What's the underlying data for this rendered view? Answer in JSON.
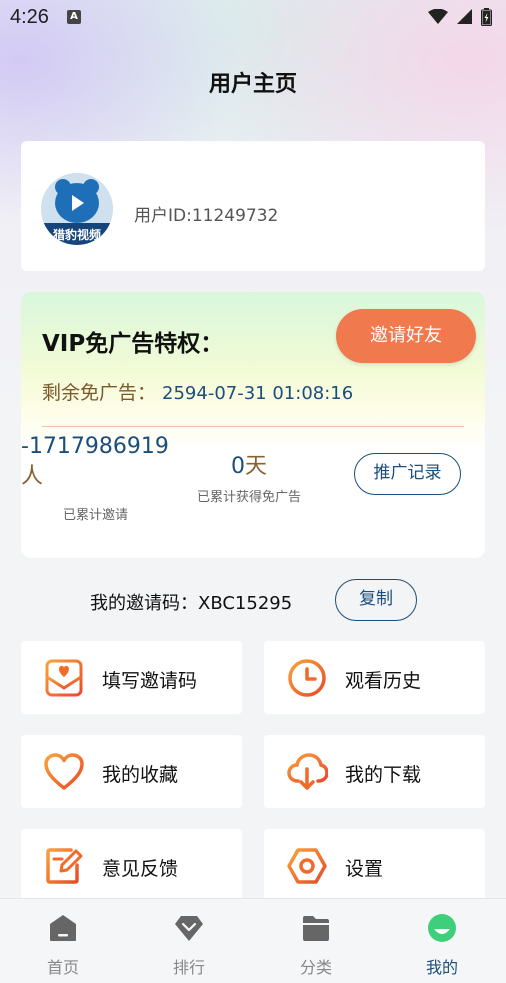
{
  "status_bar": {
    "time": "4:26",
    "icons": [
      "accessibility-a-icon",
      "wifi-icon",
      "signal-icon",
      "battery-icon"
    ]
  },
  "header": {
    "title": "用户主页"
  },
  "profile": {
    "user_id_text": "用户ID:11249732",
    "avatar": {
      "icon": "bear-play-logo",
      "caption": "猎豹视频"
    }
  },
  "vip": {
    "title": "VIP免广告特权：",
    "invite_button": "邀请好友",
    "remaining_label": "剩余免广告：",
    "remaining_date": "2594-07-31 01:08:16",
    "stats": {
      "invited_value": "-1717986919",
      "invited_unit": "人",
      "invited_label": "已累计邀请",
      "earned_value": "0",
      "earned_unit": "天",
      "earned_label": "已累计获得免广告"
    },
    "promo_button": "推广记录"
  },
  "invite_code": {
    "label": "我的邀请码：XBC15295",
    "copy_button": "复制"
  },
  "menu": [
    {
      "label": "填写邀请码",
      "icon": "envelope-heart-icon"
    },
    {
      "label": "观看历史",
      "icon": "clock-icon"
    },
    {
      "label": "我的收藏",
      "icon": "heart-icon"
    },
    {
      "label": "我的下载",
      "icon": "cloud-download-icon"
    },
    {
      "label": "意见反馈",
      "icon": "edit-note-icon"
    },
    {
      "label": "设置",
      "icon": "hexagon-gear-icon"
    }
  ],
  "bottom_nav": [
    {
      "label": "首页",
      "icon": "home-icon",
      "active": false
    },
    {
      "label": "排行",
      "icon": "diamond-icon",
      "active": false
    },
    {
      "label": "分类",
      "icon": "folder-icon",
      "active": false
    },
    {
      "label": "我的",
      "icon": "profile-face-icon",
      "active": true
    }
  ],
  "colors": {
    "accent": "#f07a4e",
    "primary_blue": "#1b4e7a",
    "active_nav_green": "#3fcf7a",
    "icon_orange": "#f06a2a"
  }
}
